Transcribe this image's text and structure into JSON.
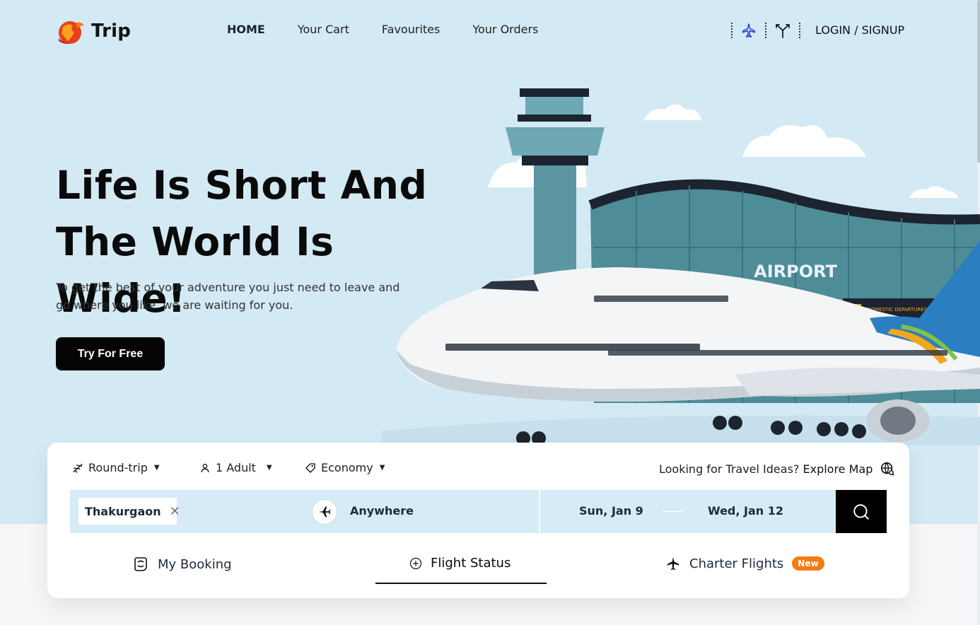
{
  "brand": {
    "name": "Trip",
    "accent": "#f47c13"
  },
  "nav": [
    {
      "label": "HOME",
      "active": true
    },
    {
      "label": "Your Cart",
      "active": false
    },
    {
      "label": "Favourites",
      "active": false
    },
    {
      "label": "Your Orders",
      "active": false
    }
  ],
  "header": {
    "icons": [
      "flight-icon",
      "route-fork-icon"
    ],
    "login_label": "LOGIN / SIGNUP"
  },
  "hero": {
    "title_line1": "Life Is Short And",
    "title_line2": "The World Is Wide!",
    "subtitle": "To get the best of your adventure you just need to leave and go where you like. we are waiting for you.",
    "cta_label": "Try For Free",
    "illustration_sign": "AIRPORT",
    "board_text": "DOMESTIC DEPARTURES"
  },
  "search": {
    "trip_type": "Round-trip",
    "travellers": "1 Adult",
    "cabin": "Economy",
    "explore_prefix": "Looking for Travel Ideas?",
    "explore_link": "Explore Map",
    "from_value": "Thakurgaon",
    "to_value": "Anywhere",
    "depart_date": "Sun, Jan 9",
    "return_date": "Wed, Jan 12"
  },
  "tabs": [
    {
      "label": "My Booking",
      "icon": "booking-icon"
    },
    {
      "label": "Flight Status",
      "icon": "plus-circle-icon",
      "active": true
    },
    {
      "label": "Charter Flights",
      "icon": "airplane-icon",
      "badge": "New"
    }
  ]
}
